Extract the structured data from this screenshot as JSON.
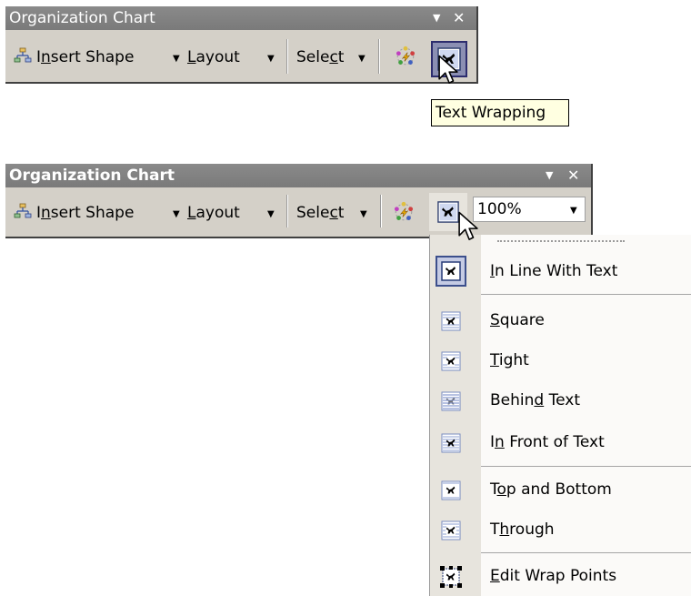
{
  "toolbar_top": {
    "title": "Organization Chart",
    "insert_shape": {
      "pre": "I",
      "u": "n",
      "post": "sert Shape"
    },
    "layout": {
      "pre": "",
      "u": "L",
      "post": "ayout"
    },
    "select": {
      "pre": "Sele",
      "u": "c",
      "post": "t"
    },
    "close_glyph": "✕",
    "menu_glyph": "▼"
  },
  "tooltip": {
    "text": "Text Wrapping"
  },
  "toolbar_bottom": {
    "title": "Organization Chart",
    "insert_shape": {
      "pre": "I",
      "u": "n",
      "post": "sert Shape"
    },
    "layout": {
      "pre": "",
      "u": "L",
      "post": "ayout"
    },
    "select": {
      "pre": "Sele",
      "u": "c",
      "post": "t"
    },
    "zoom_value": "100%",
    "close_glyph": "✕",
    "menu_glyph": "▼"
  },
  "wrap_menu": {
    "items": [
      {
        "pre": "",
        "u": "I",
        "post": "n Line With Text",
        "icon": "inline-wrap-icon",
        "selected": true
      },
      {
        "pre": "",
        "u": "S",
        "post": "quare",
        "icon": "square-wrap-icon"
      },
      {
        "pre": "",
        "u": "T",
        "post": "ight",
        "icon": "tight-wrap-icon"
      },
      {
        "pre": "Behin",
        "u": "d",
        "post": " Text",
        "icon": "behind-text-icon"
      },
      {
        "pre": "I",
        "u": "n",
        "post": " Front of Text",
        "icon": "in-front-text-icon"
      },
      {
        "pre": "T",
        "u": "o",
        "post": "p and Bottom",
        "icon": "top-bottom-wrap-icon"
      },
      {
        "pre": "T",
        "u": "h",
        "post": "rough",
        "icon": "through-wrap-icon"
      },
      {
        "pre": "",
        "u": "E",
        "post": "dit Wrap Points",
        "icon": "edit-wrap-points-icon"
      }
    ]
  },
  "colors": {
    "toolbar_bg": "#d4d0c8",
    "titlebar": "#7f7f7f",
    "tooltip_bg": "#ffffe1",
    "pressed": "#8b8fb3"
  }
}
